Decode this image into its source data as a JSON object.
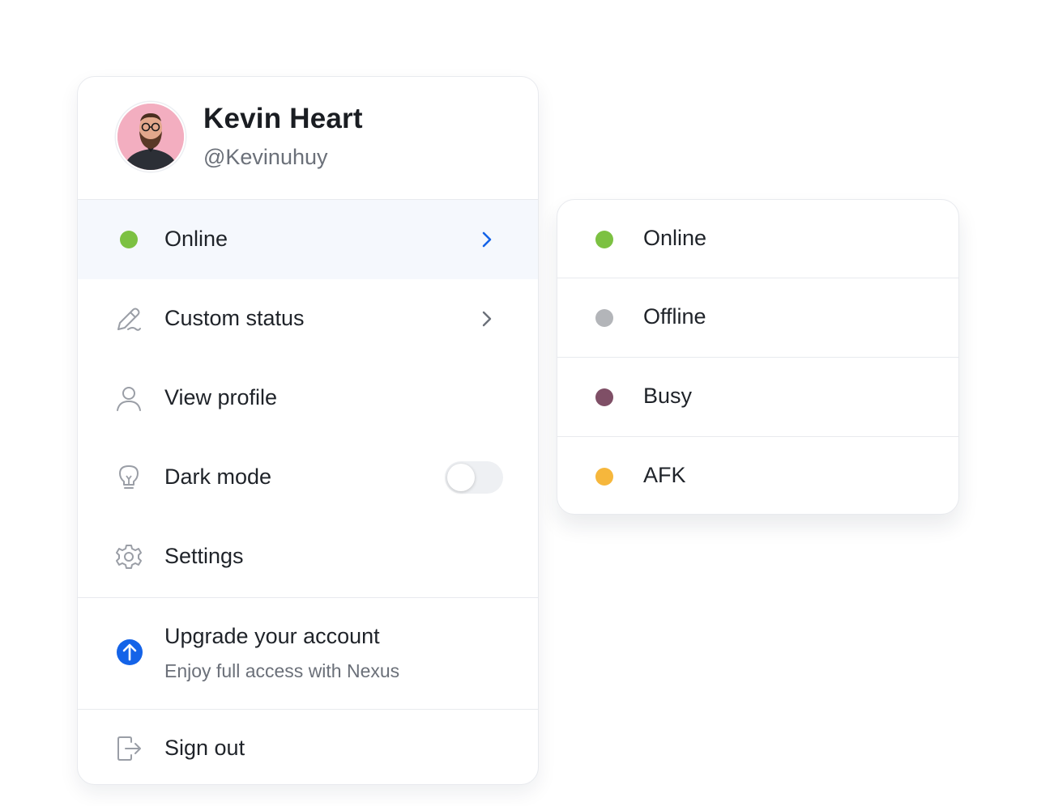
{
  "user": {
    "name": "Kevin Heart",
    "handle": "@Kevinuhuy"
  },
  "menu": {
    "status": {
      "label": "Online",
      "color": "#7cc142"
    },
    "custom_status": "Custom status",
    "view_profile": "View profile",
    "dark_mode": {
      "label": "Dark mode",
      "enabled": false
    },
    "settings": "Settings",
    "upgrade": {
      "title": "Upgrade your account",
      "subtitle": "Enjoy full access with Nexus",
      "accent": "#1463e8"
    },
    "sign_out": "Sign out"
  },
  "status_options": [
    {
      "label": "Online",
      "color": "#7cc142"
    },
    {
      "label": "Offline",
      "color": "#b3b5b9"
    },
    {
      "label": "Busy",
      "color": "#7f4f66"
    },
    {
      "label": "AFK",
      "color": "#f6b73c"
    }
  ],
  "colors": {
    "chevron_active": "#1463e8",
    "chevron_default": "#6b7079",
    "icon_gray": "#9a9ea6"
  }
}
